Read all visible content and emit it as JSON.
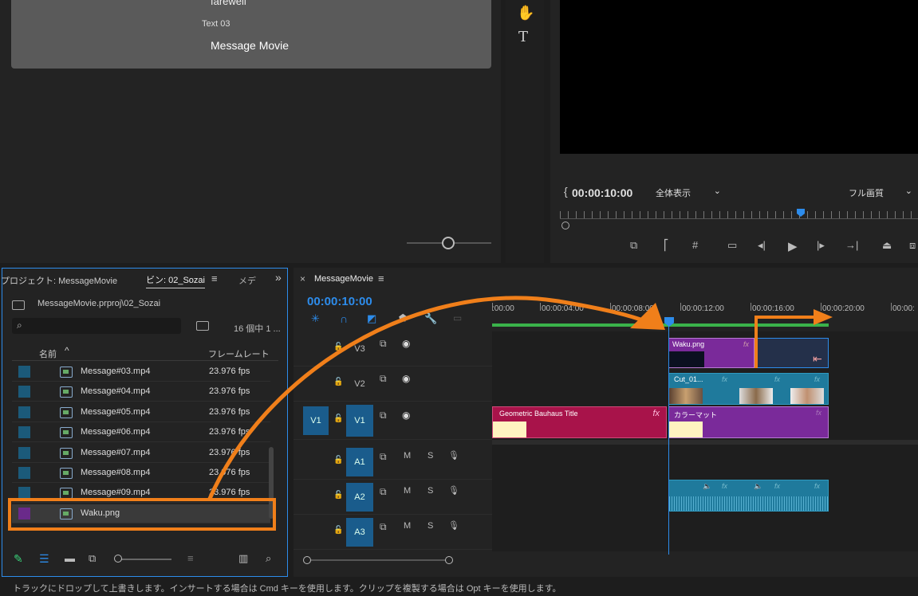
{
  "preview": {
    "partial_text": "farewell",
    "text_label": "Text 03",
    "text_value": "Message Movie"
  },
  "program_monitor": {
    "timecode": "00:00:10:00",
    "fit_dropdown": "全体表示",
    "quality_dropdown": "フル画質"
  },
  "project_panel": {
    "tab_project": "プロジェクト: MessageMovie",
    "tab_bin": "ビン: 02_Sozai",
    "tab_media": "メデ",
    "path": "MessageMovie.prproj\\02_Sozai",
    "item_count": "16 個中 1 ...",
    "col_name": "名前",
    "col_framerate": "フレームレート",
    "items": [
      {
        "name": "Message#03.mp4",
        "fps": "23.976 fps",
        "color": "#1b5a7a"
      },
      {
        "name": "Message#04.mp4",
        "fps": "23.976 fps",
        "color": "#1b5a7a"
      },
      {
        "name": "Message#05.mp4",
        "fps": "23.976 fps",
        "color": "#1b5a7a"
      },
      {
        "name": "Message#06.mp4",
        "fps": "23.976 fps",
        "color": "#1b5a7a"
      },
      {
        "name": "Message#07.mp4",
        "fps": "23.976 fps",
        "color": "#1b5a7a"
      },
      {
        "name": "Message#08.mp4",
        "fps": "23.976 fps",
        "color": "#1b5a7a"
      },
      {
        "name": "Message#09.mp4",
        "fps": "23.976 fps",
        "color": "#1b5a7a"
      },
      {
        "name": "Waku.png",
        "fps": "",
        "color": "#6a2a8a"
      }
    ]
  },
  "timeline": {
    "tab_close": "×",
    "sequence_name": "MessageMovie",
    "timecode": "00:00:10:00",
    "ruler_labels": [
      ":00:00",
      "00:00:04:00",
      "00:00:08:00",
      "00:00:12:00",
      "00:00:16:00",
      "00:00:20:00",
      "00:00:"
    ],
    "tracks": {
      "v3": "V3",
      "v2": "V2",
      "v1_src": "V1",
      "v1": "V1",
      "a1": "A1",
      "a2": "A2",
      "a3": "A3",
      "mute": "M",
      "solo": "S"
    },
    "clips": {
      "waku": "Waku.png",
      "cut": "Cut_01...",
      "geometric": "Geometric Bauhaus Title",
      "color_matte": "カラーマット",
      "fx": "fx"
    }
  },
  "status_bar": {
    "message": "トラックにドロップして上書きします。インサートする場合は Cmd キーを使用します。クリップを複製する場合は Opt キーを使用します。"
  },
  "colors": {
    "accent_blue": "#2d8ceb",
    "arrow_orange": "#f07f1a",
    "clip_purple": "#7a2a9a",
    "clip_crimson": "#a8134a",
    "clip_teal": "#1f7a9c"
  }
}
